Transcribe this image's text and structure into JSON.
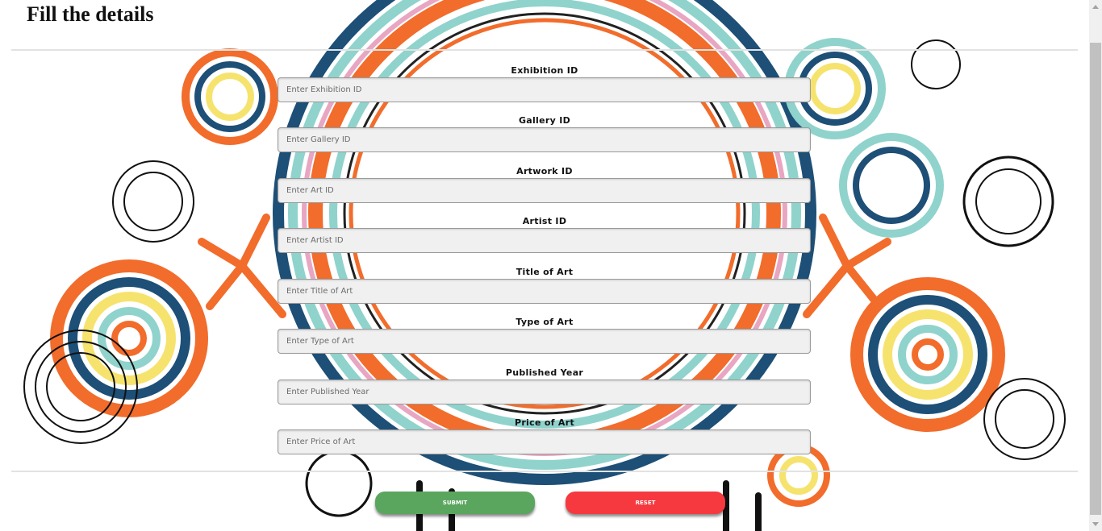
{
  "page": {
    "title": "Fill the details"
  },
  "form": {
    "fields": [
      {
        "label": "Exhibition ID",
        "placeholder": "Enter Exhibition ID",
        "value": ""
      },
      {
        "label": "Gallery ID",
        "placeholder": "Enter Gallery ID",
        "value": ""
      },
      {
        "label": "Artwork ID",
        "placeholder": "Enter Art ID",
        "value": ""
      },
      {
        "label": "Artist ID",
        "placeholder": "Enter Artist ID",
        "value": ""
      },
      {
        "label": "Title of Art",
        "placeholder": "Enter Title of Art",
        "value": ""
      },
      {
        "label": "Type of Art",
        "placeholder": "Enter Type of Art",
        "value": ""
      },
      {
        "label": "Published Year",
        "placeholder": "Enter Published Year",
        "value": ""
      },
      {
        "label": "Price of Art",
        "placeholder": "Enter Price of Art",
        "value": ""
      }
    ],
    "submit_label": "SUBMIT",
    "reset_label": "RESET"
  },
  "colors": {
    "submit": "#5aa65e",
    "reset": "#f5393f",
    "input_bg": "#f0f0f0",
    "art_orange": "#f26c2b",
    "art_teal": "#8fd3cc",
    "art_navy": "#1d4f77",
    "art_yellow": "#f6e36e",
    "art_pink": "#e8a6c2"
  },
  "icons": {
    "background": "decorative-floral-swirl-background",
    "scroll_up": "arrow-up-icon",
    "scroll_down": "arrow-down-icon"
  }
}
